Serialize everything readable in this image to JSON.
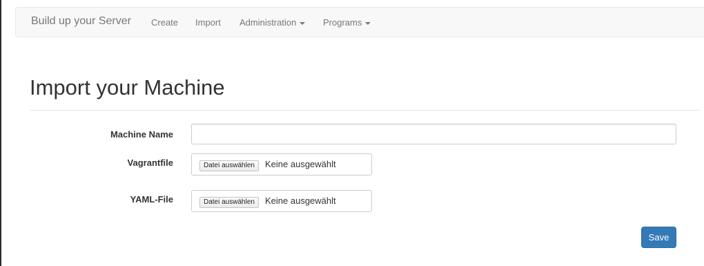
{
  "navbar": {
    "brand": "Build up your Server",
    "links": [
      {
        "label": "Create"
      },
      {
        "label": "Import"
      },
      {
        "label": "Administration"
      },
      {
        "label": "Programs"
      }
    ]
  },
  "page": {
    "title": "Import your Machine"
  },
  "form": {
    "machine_name": {
      "label": "Machine Name",
      "value": "",
      "placeholder": ""
    },
    "vagrantfile": {
      "label": "Vagrantfile",
      "button_label": "Datei auswählen",
      "status": "Keine ausgewählt"
    },
    "yaml_file": {
      "label": "YAML-File",
      "button_label": "Datei auswählen",
      "status": "Keine ausgewählt"
    },
    "save_label": "Save"
  },
  "colors": {
    "navbar_bg": "#f8f8f8",
    "primary": "#337ab7",
    "text": "#333333",
    "muted": "#777777"
  },
  "icons": {
    "dropdown": "caret-down-icon"
  }
}
